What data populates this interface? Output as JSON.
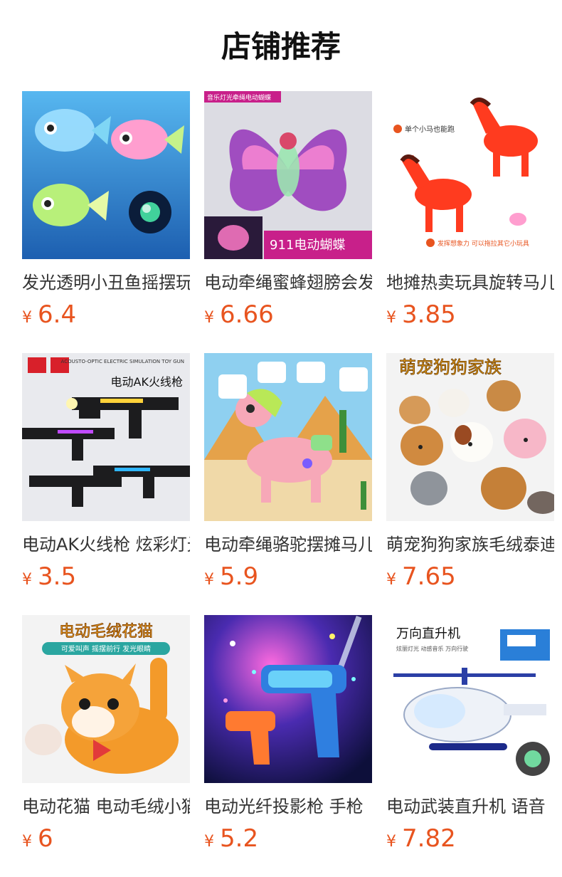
{
  "section": {
    "title": "店铺推荐"
  },
  "accent_color": "#e8541f",
  "products": [
    {
      "name": "发光透明小丑鱼摇摆玩具",
      "currency": "¥",
      "price": "6.4",
      "image": {
        "icon": "clownfish-toy-image",
        "bg": "#2f8fd8"
      }
    },
    {
      "name": "电动牵绳蜜蜂翅膀会发光",
      "currency": "¥",
      "price": "6.66",
      "image": {
        "icon": "butterfly-toy-image",
        "bg": "#d9d9df",
        "caption": "911电动蝴蝶",
        "badge": "音乐灯光牵绳电动蝴蝶"
      }
    },
    {
      "name": "地摊热卖玩具旋转马儿",
      "currency": "¥",
      "price": "3.85",
      "image": {
        "icon": "horse-toy-image",
        "bg": "#ffffff",
        "tag1": "单个小马也能跑",
        "tag2": "发挥想象力 可以拖拉其它小玩具"
      }
    },
    {
      "name": "电动AK火线枪 炫彩灯光",
      "currency": "¥",
      "price": "3.5",
      "image": {
        "icon": "toy-gun-image",
        "bg": "#e8e8ea",
        "caption": "电动AK火线枪",
        "header": "ACOUSTO-OPTIC ELECTRIC SIMULATION TOY GUN"
      }
    },
    {
      "name": "电动牵绳骆驼摆摊马儿",
      "currency": "¥",
      "price": "5.9",
      "image": {
        "icon": "camel-toy-image",
        "bg": "#8fd0f0"
      }
    },
    {
      "name": "萌宠狗狗家族毛绒泰迪",
      "currency": "¥",
      "price": "7.65",
      "image": {
        "icon": "plush-dogs-image",
        "bg": "#f5f5f5",
        "caption": "萌宠狗狗家族"
      }
    },
    {
      "name": "电动花猫 电动毛绒小猫",
      "currency": "¥",
      "price": "6",
      "image": {
        "icon": "plush-cat-image",
        "bg": "#f4f4f4",
        "caption": "电动毛绒花猫",
        "sub": "可爱叫声 摇摆前行 发光眼睛"
      }
    },
    {
      "name": "电动光纤投影枪 手枪",
      "currency": "¥",
      "price": "5.2",
      "image": {
        "icon": "projection-gun-image",
        "bg": "#1b1f5a"
      }
    },
    {
      "name": "电动武装直升机 语音",
      "currency": "¥",
      "price": "7.82",
      "image": {
        "icon": "helicopter-toy-image",
        "bg": "#ffffff",
        "caption": "万向直升机",
        "sub": "炫丽灯光 动感音乐 万向行驶"
      }
    }
  ]
}
